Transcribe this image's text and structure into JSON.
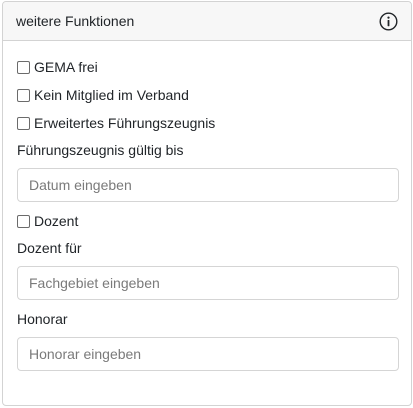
{
  "header": {
    "title": "weitere Funktionen",
    "info_icon": "info-circle-icon"
  },
  "checkboxes": [
    {
      "label": "GEMA frei",
      "checked": false
    },
    {
      "label": "Kein Mitglied im Verband",
      "checked": false
    },
    {
      "label": "Erweitertes Führungszeugnis",
      "checked": false
    }
  ],
  "fuehrungszeugnis": {
    "label": "Führungszeugnis gültig bis",
    "placeholder": "Datum eingeben",
    "value": ""
  },
  "dozent_checkbox": {
    "label": "Dozent",
    "checked": false
  },
  "dozent_fuer": {
    "label": "Dozent für",
    "placeholder": "Fachgebiet eingeben",
    "value": ""
  },
  "honorar": {
    "label": "Honorar",
    "placeholder": "Honorar eingeben",
    "value": ""
  },
  "colors": {
    "header_bg": "#f7f7f7",
    "border": "#d3d3d3",
    "text": "#212529",
    "placeholder": "#7a7a7a"
  }
}
